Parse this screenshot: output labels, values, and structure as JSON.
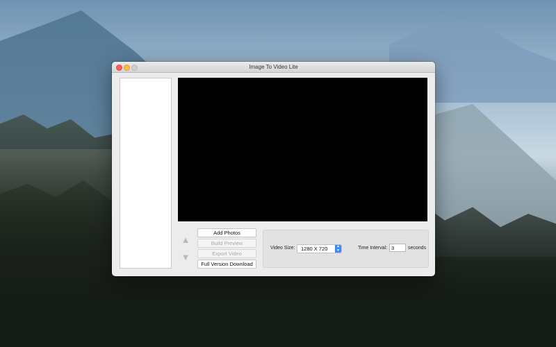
{
  "window": {
    "title": "Image To Video Lite"
  },
  "controls": {
    "add_photos": "Add Photos",
    "build_preview": "Build Preview",
    "export_video": "Export Video",
    "full_version": "Full Version Download"
  },
  "settings": {
    "video_size_label": "Video Size:",
    "video_size_value": "1280 X 720",
    "time_interval_label": "Time Interval:",
    "time_interval_value": "3",
    "seconds_label": "seconds"
  },
  "colors": {
    "preview_background": "#000000",
    "select_accent": "#3c8cf7",
    "close": "#fc605c",
    "minimize": "#fdbc40"
  }
}
